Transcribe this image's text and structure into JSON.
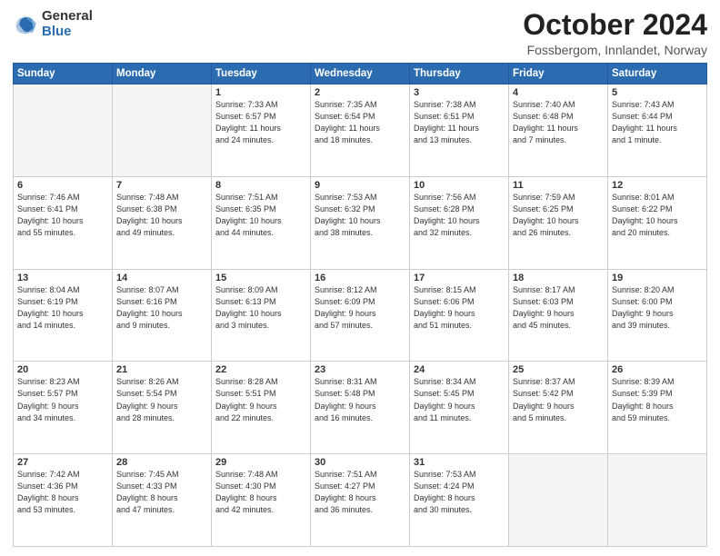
{
  "header": {
    "logo_general": "General",
    "logo_blue": "Blue",
    "title": "October 2024",
    "subtitle": "Fossbergom, Innlandet, Norway"
  },
  "weekdays": [
    "Sunday",
    "Monday",
    "Tuesday",
    "Wednesday",
    "Thursday",
    "Friday",
    "Saturday"
  ],
  "weeks": [
    [
      {
        "day": "",
        "detail": ""
      },
      {
        "day": "",
        "detail": ""
      },
      {
        "day": "1",
        "detail": "Sunrise: 7:33 AM\nSunset: 6:57 PM\nDaylight: 11 hours\nand 24 minutes."
      },
      {
        "day": "2",
        "detail": "Sunrise: 7:35 AM\nSunset: 6:54 PM\nDaylight: 11 hours\nand 18 minutes."
      },
      {
        "day": "3",
        "detail": "Sunrise: 7:38 AM\nSunset: 6:51 PM\nDaylight: 11 hours\nand 13 minutes."
      },
      {
        "day": "4",
        "detail": "Sunrise: 7:40 AM\nSunset: 6:48 PM\nDaylight: 11 hours\nand 7 minutes."
      },
      {
        "day": "5",
        "detail": "Sunrise: 7:43 AM\nSunset: 6:44 PM\nDaylight: 11 hours\nand 1 minute."
      }
    ],
    [
      {
        "day": "6",
        "detail": "Sunrise: 7:46 AM\nSunset: 6:41 PM\nDaylight: 10 hours\nand 55 minutes."
      },
      {
        "day": "7",
        "detail": "Sunrise: 7:48 AM\nSunset: 6:38 PM\nDaylight: 10 hours\nand 49 minutes."
      },
      {
        "day": "8",
        "detail": "Sunrise: 7:51 AM\nSunset: 6:35 PM\nDaylight: 10 hours\nand 44 minutes."
      },
      {
        "day": "9",
        "detail": "Sunrise: 7:53 AM\nSunset: 6:32 PM\nDaylight: 10 hours\nand 38 minutes."
      },
      {
        "day": "10",
        "detail": "Sunrise: 7:56 AM\nSunset: 6:28 PM\nDaylight: 10 hours\nand 32 minutes."
      },
      {
        "day": "11",
        "detail": "Sunrise: 7:59 AM\nSunset: 6:25 PM\nDaylight: 10 hours\nand 26 minutes."
      },
      {
        "day": "12",
        "detail": "Sunrise: 8:01 AM\nSunset: 6:22 PM\nDaylight: 10 hours\nand 20 minutes."
      }
    ],
    [
      {
        "day": "13",
        "detail": "Sunrise: 8:04 AM\nSunset: 6:19 PM\nDaylight: 10 hours\nand 14 minutes."
      },
      {
        "day": "14",
        "detail": "Sunrise: 8:07 AM\nSunset: 6:16 PM\nDaylight: 10 hours\nand 9 minutes."
      },
      {
        "day": "15",
        "detail": "Sunrise: 8:09 AM\nSunset: 6:13 PM\nDaylight: 10 hours\nand 3 minutes."
      },
      {
        "day": "16",
        "detail": "Sunrise: 8:12 AM\nSunset: 6:09 PM\nDaylight: 9 hours\nand 57 minutes."
      },
      {
        "day": "17",
        "detail": "Sunrise: 8:15 AM\nSunset: 6:06 PM\nDaylight: 9 hours\nand 51 minutes."
      },
      {
        "day": "18",
        "detail": "Sunrise: 8:17 AM\nSunset: 6:03 PM\nDaylight: 9 hours\nand 45 minutes."
      },
      {
        "day": "19",
        "detail": "Sunrise: 8:20 AM\nSunset: 6:00 PM\nDaylight: 9 hours\nand 39 minutes."
      }
    ],
    [
      {
        "day": "20",
        "detail": "Sunrise: 8:23 AM\nSunset: 5:57 PM\nDaylight: 9 hours\nand 34 minutes."
      },
      {
        "day": "21",
        "detail": "Sunrise: 8:26 AM\nSunset: 5:54 PM\nDaylight: 9 hours\nand 28 minutes."
      },
      {
        "day": "22",
        "detail": "Sunrise: 8:28 AM\nSunset: 5:51 PM\nDaylight: 9 hours\nand 22 minutes."
      },
      {
        "day": "23",
        "detail": "Sunrise: 8:31 AM\nSunset: 5:48 PM\nDaylight: 9 hours\nand 16 minutes."
      },
      {
        "day": "24",
        "detail": "Sunrise: 8:34 AM\nSunset: 5:45 PM\nDaylight: 9 hours\nand 11 minutes."
      },
      {
        "day": "25",
        "detail": "Sunrise: 8:37 AM\nSunset: 5:42 PM\nDaylight: 9 hours\nand 5 minutes."
      },
      {
        "day": "26",
        "detail": "Sunrise: 8:39 AM\nSunset: 5:39 PM\nDaylight: 8 hours\nand 59 minutes."
      }
    ],
    [
      {
        "day": "27",
        "detail": "Sunrise: 7:42 AM\nSunset: 4:36 PM\nDaylight: 8 hours\nand 53 minutes."
      },
      {
        "day": "28",
        "detail": "Sunrise: 7:45 AM\nSunset: 4:33 PM\nDaylight: 8 hours\nand 47 minutes."
      },
      {
        "day": "29",
        "detail": "Sunrise: 7:48 AM\nSunset: 4:30 PM\nDaylight: 8 hours\nand 42 minutes."
      },
      {
        "day": "30",
        "detail": "Sunrise: 7:51 AM\nSunset: 4:27 PM\nDaylight: 8 hours\nand 36 minutes."
      },
      {
        "day": "31",
        "detail": "Sunrise: 7:53 AM\nSunset: 4:24 PM\nDaylight: 8 hours\nand 30 minutes."
      },
      {
        "day": "",
        "detail": ""
      },
      {
        "day": "",
        "detail": ""
      }
    ]
  ]
}
